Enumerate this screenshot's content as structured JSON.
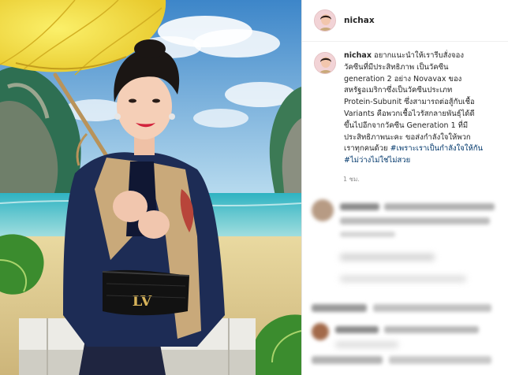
{
  "profile": {
    "username": "nichax",
    "avatar": "profile-avatar"
  },
  "caption": {
    "username": "nichax",
    "lines": [
      "อยากแนะนำให้เรารีบสั่งจอง",
      "วัคซีนที่มีประสิทธิภาพ เป็นวัคซีน",
      "generation 2 อย่าง Novavax ของ",
      "สหรัฐอเมริกาซึ่งเป็นวัคซีนประเภท",
      "Protein-Subunit ซึ่งสามารถต่อสู้กับเชื้อ",
      "Variants คือพวกเชื้อไวรัสกลายพันธุ์ได้ดี",
      "ขึ้นไปอีกจากวัคซีน Generation 1 ที่มี",
      "ประสิทธิภาพนะคะ ขอส่งกำลังใจให้พวก",
      "เราทุกคนด้วย"
    ],
    "hashtags": [
      "#เพราะเราเป็นกำลังใจให้กัน",
      "#ไม่ว่างไม่ใช่ไม่สวย"
    ],
    "time": "1 ชม."
  },
  "colors": {
    "hashtag": "#00376b",
    "text": "#262626",
    "muted": "#8e8e8e",
    "divider": "#efefef"
  },
  "photo": {
    "description_icon": "post-photo"
  }
}
